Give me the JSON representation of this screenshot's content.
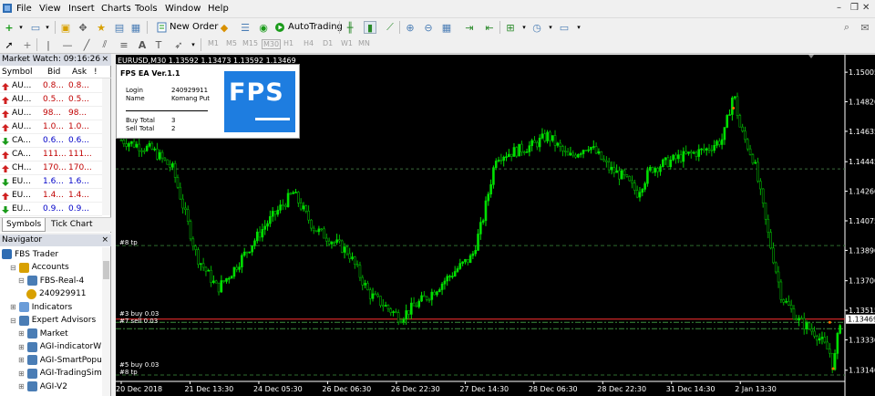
{
  "menu": {
    "items": [
      "File",
      "View",
      "Insert",
      "Charts",
      "Tools",
      "Window",
      "Help"
    ],
    "window_controls": [
      "–",
      "❒",
      "✕"
    ]
  },
  "toolbar": {
    "new_order_label": "New Order",
    "autotrading_label": "AutoTrading",
    "timeframes": [
      "M1",
      "M5",
      "M15",
      "M30",
      "H1",
      "H4",
      "D1",
      "W1",
      "MN"
    ]
  },
  "market_watch": {
    "title": "Market Watch: 09:16:26",
    "columns": [
      "Symbol",
      "Bid",
      "Ask",
      "!"
    ],
    "rows": [
      {
        "symbol": "AU...",
        "bid": "0.8...",
        "ask": "0.8...",
        "dir": "up",
        "color": "red"
      },
      {
        "symbol": "AU...",
        "bid": "0.5...",
        "ask": "0.5...",
        "dir": "up",
        "color": "red"
      },
      {
        "symbol": "AU...",
        "bid": "98...",
        "ask": "98...",
        "dir": "up",
        "color": "red"
      },
      {
        "symbol": "AU...",
        "bid": "1.0...",
        "ask": "1.0...",
        "dir": "up",
        "color": "red"
      },
      {
        "symbol": "CA...",
        "bid": "0.6...",
        "ask": "0.6...",
        "dir": "down",
        "color": "blue"
      },
      {
        "symbol": "CA...",
        "bid": "111...",
        "ask": "111...",
        "dir": "up",
        "color": "red"
      },
      {
        "symbol": "CH...",
        "bid": "170...",
        "ask": "170...",
        "dir": "up",
        "color": "red"
      },
      {
        "symbol": "EU...",
        "bid": "1.6...",
        "ask": "1.6...",
        "dir": "down",
        "color": "blue"
      },
      {
        "symbol": "EU...",
        "bid": "1.4...",
        "ask": "1.4...",
        "dir": "up",
        "color": "red"
      },
      {
        "symbol": "EU...",
        "bid": "0.9...",
        "ask": "0.9...",
        "dir": "down",
        "color": "blue"
      }
    ],
    "tabs": [
      "Symbols",
      "Tick Chart"
    ]
  },
  "navigator": {
    "title": "Navigator",
    "items": [
      {
        "label": "FBS Trader",
        "indent": 0,
        "icon": "app-icon"
      },
      {
        "label": "Accounts",
        "indent": 1,
        "icon": "accounts-icon"
      },
      {
        "label": "FBS-Real-4",
        "indent": 2,
        "icon": "server-icon"
      },
      {
        "label": "240929911",
        "indent": 3,
        "icon": "user-icon"
      },
      {
        "label": "Indicators",
        "indent": 1,
        "icon": "indicators-icon"
      },
      {
        "label": "Expert Advisors",
        "indent": 1,
        "icon": "expert-icon"
      },
      {
        "label": "Market",
        "indent": 2,
        "icon": "expert-icon"
      },
      {
        "label": "AGI-indicatorW",
        "indent": 2,
        "icon": "expert-icon"
      },
      {
        "label": "AGI-SmartPopu",
        "indent": 2,
        "icon": "expert-icon"
      },
      {
        "label": "AGI-TradingSim",
        "indent": 2,
        "icon": "expert-icon"
      },
      {
        "label": "AGI-V2",
        "indent": 2,
        "icon": "expert-icon"
      }
    ]
  },
  "chart": {
    "header": "EURUSD,M30  1.13592 1.13473 1.13592 1.13469",
    "ea_panel": {
      "title": "FPS EA Ver.1.1",
      "login_label": "Login",
      "login_value": "240929911",
      "name_label": "Name",
      "name_value": "Komang Put",
      "buy_label": "Buy Total",
      "buy_value": "3",
      "sell_label": "Sell Total",
      "sell_value": "2",
      "logo_text": "FPS"
    },
    "annotations": {
      "tp_upper": "#8 tp",
      "buy_line": "#3 buy 0.03",
      "sell_line": "#7 sell 0.03",
      "bottom_1": "#5 buy 0.03",
      "bottom_2": "#8 tp"
    },
    "current_price": "1.13469",
    "colors": {
      "bull": "#00e000",
      "bg": "#000000",
      "ask_line": "#ff3030",
      "grid": "#2a5a2a"
    }
  },
  "chart_data": {
    "type": "candlestick",
    "symbol": "EURUSD",
    "timeframe": "M30",
    "y_ticks": [
      "1.15005",
      "1.14820",
      "1.14635",
      "1.14445",
      "1.14260",
      "1.14075",
      "1.13890",
      "1.13700",
      "1.13515",
      "1.13330",
      "1.13140"
    ],
    "ylim": [
      1.1307,
      1.1508
    ],
    "x_ticks": [
      "20 Dec 2018",
      "21 Dec 13:30",
      "24 Dec 05:30",
      "26 Dec 06:30",
      "26 Dec 22:30",
      "27 Dec 14:30",
      "28 Dec 06:30",
      "28 Dec 22:30",
      "31 Dec 14:30",
      "2 Jan 13:30"
    ],
    "x_positions": [
      0,
      1,
      2,
      3,
      4,
      5,
      6,
      7,
      8,
      9
    ],
    "price_path": [
      [
        0,
        1.1458
      ],
      [
        0.45,
        1.1452
      ],
      [
        0.75,
        1.144
      ],
      [
        1.1,
        1.1385
      ],
      [
        1.4,
        1.1365
      ],
      [
        1.6,
        1.1375
      ],
      [
        2.1,
        1.1405
      ],
      [
        2.5,
        1.1425
      ],
      [
        2.8,
        1.1403
      ],
      [
        3.3,
        1.1388
      ],
      [
        3.6,
        1.1362
      ],
      [
        4.05,
        1.1347
      ],
      [
        4.5,
        1.1362
      ],
      [
        4.9,
        1.1378
      ],
      [
        5.1,
        1.1385
      ],
      [
        5.25,
        1.1407
      ],
      [
        5.45,
        1.1448
      ],
      [
        5.65,
        1.145
      ],
      [
        6.0,
        1.1455
      ],
      [
        6.2,
        1.1461
      ],
      [
        6.5,
        1.1447
      ],
      [
        6.8,
        1.1455
      ],
      [
        7.1,
        1.144
      ],
      [
        7.3,
        1.1435
      ],
      [
        7.5,
        1.1425
      ],
      [
        7.7,
        1.144
      ],
      [
        8.1,
        1.1447
      ],
      [
        8.5,
        1.1452
      ],
      [
        8.75,
        1.1459
      ],
      [
        8.9,
        1.1488
      ],
      [
        9.0,
        1.1465
      ],
      [
        9.2,
        1.1445
      ],
      [
        9.4,
        1.14
      ],
      [
        9.6,
        1.136
      ],
      [
        9.85,
        1.1345
      ],
      [
        10.1,
        1.1337
      ],
      [
        10.3,
        1.1325
      ],
      [
        10.35,
        1.1315
      ],
      [
        10.45,
        1.1345
      ]
    ],
    "ask_price": 1.1346,
    "buy_level": 1.1344,
    "sell_level": 1.134,
    "tp_level": 1.1392,
    "bottom_tp_level": 1.1311
  }
}
